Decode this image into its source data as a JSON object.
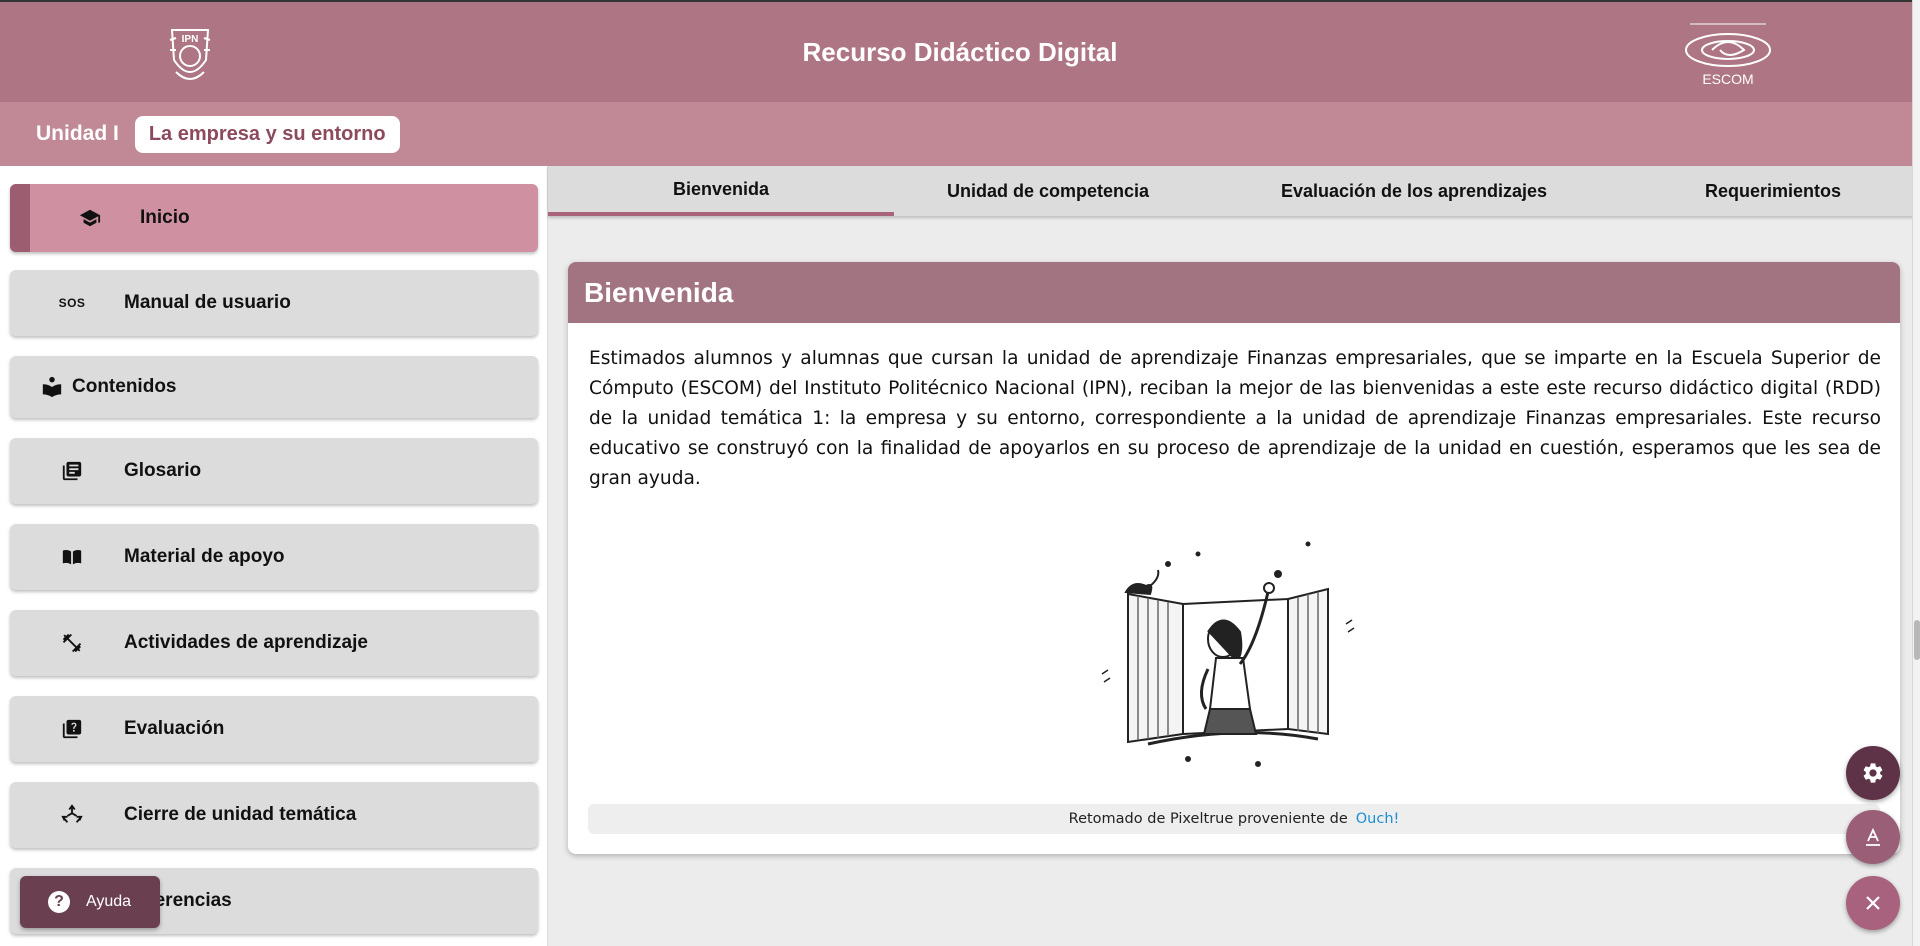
{
  "header": {
    "title": "Recurso Didáctico Digital",
    "logo_left": "ipn-logo",
    "logo_right": "escom-logo",
    "logo_right_text": "ESCOM",
    "logo_left_text": "IPN"
  },
  "unit": {
    "label": "Unidad I",
    "topic": "La empresa y su entorno"
  },
  "sidebar": {
    "items": [
      {
        "label": "Inicio",
        "icon": "graduation-cap-icon",
        "active": true
      },
      {
        "label": "Manual de usuario",
        "icon": "sos-icon",
        "icon_text": "SOS"
      },
      {
        "label": "Contenidos",
        "icon": "book-reader-icon"
      },
      {
        "label": "Glosario",
        "icon": "library-books-icon"
      },
      {
        "label": "Material de apoyo",
        "icon": "open-book-icon"
      },
      {
        "label": "Actividades de aprendizaje",
        "icon": "fitness-icon"
      },
      {
        "label": "Evaluación",
        "icon": "quiz-icon"
      },
      {
        "label": "Cierre de unidad temática",
        "icon": "recycle-icon"
      },
      {
        "label": "Referencias",
        "icon": "references-icon"
      }
    ]
  },
  "tabs": [
    {
      "label": "Bienvenida",
      "active": true
    },
    {
      "label": "Unidad de competencia"
    },
    {
      "label": "Evaluación de los aprendizajes"
    },
    {
      "label": "Requerimientos"
    }
  ],
  "welcome": {
    "heading": "Bienvenida",
    "body": "Estimados alumnos y alumnas que cursan la unidad de aprendizaje Finanzas empresariales, que se imparte en la Escuela Superior de Cómputo (ESCOM) del Instituto Politécnico Nacional (IPN), reciban la mejor de las bienvenidas a este este recurso didáctico digital (RDD) de la unidad temática 1: la empresa y su entorno, correspondiente a la unidad de aprendizaje Finanzas empresariales. Este recurso educativo se construyó con la finalidad de apoyarlos en su proceso de aprendizaje de la unidad en cuestión, esperamos que les sea de gran ayuda.",
    "image": "woman-waving-window-illustration",
    "credit_text": "Retomado de Pixeltrue proveniente de",
    "credit_link": "Ouch!"
  },
  "help": {
    "label": "Ayuda"
  },
  "fabs": {
    "settings": "gear-icon",
    "text_size": "font-icon",
    "close": "close-icon"
  },
  "colors": {
    "header": "#ae7584",
    "unitbar": "#c08995",
    "active_item": "#cf91a2",
    "card_header": "#a27380",
    "link": "#1a8fd6"
  }
}
